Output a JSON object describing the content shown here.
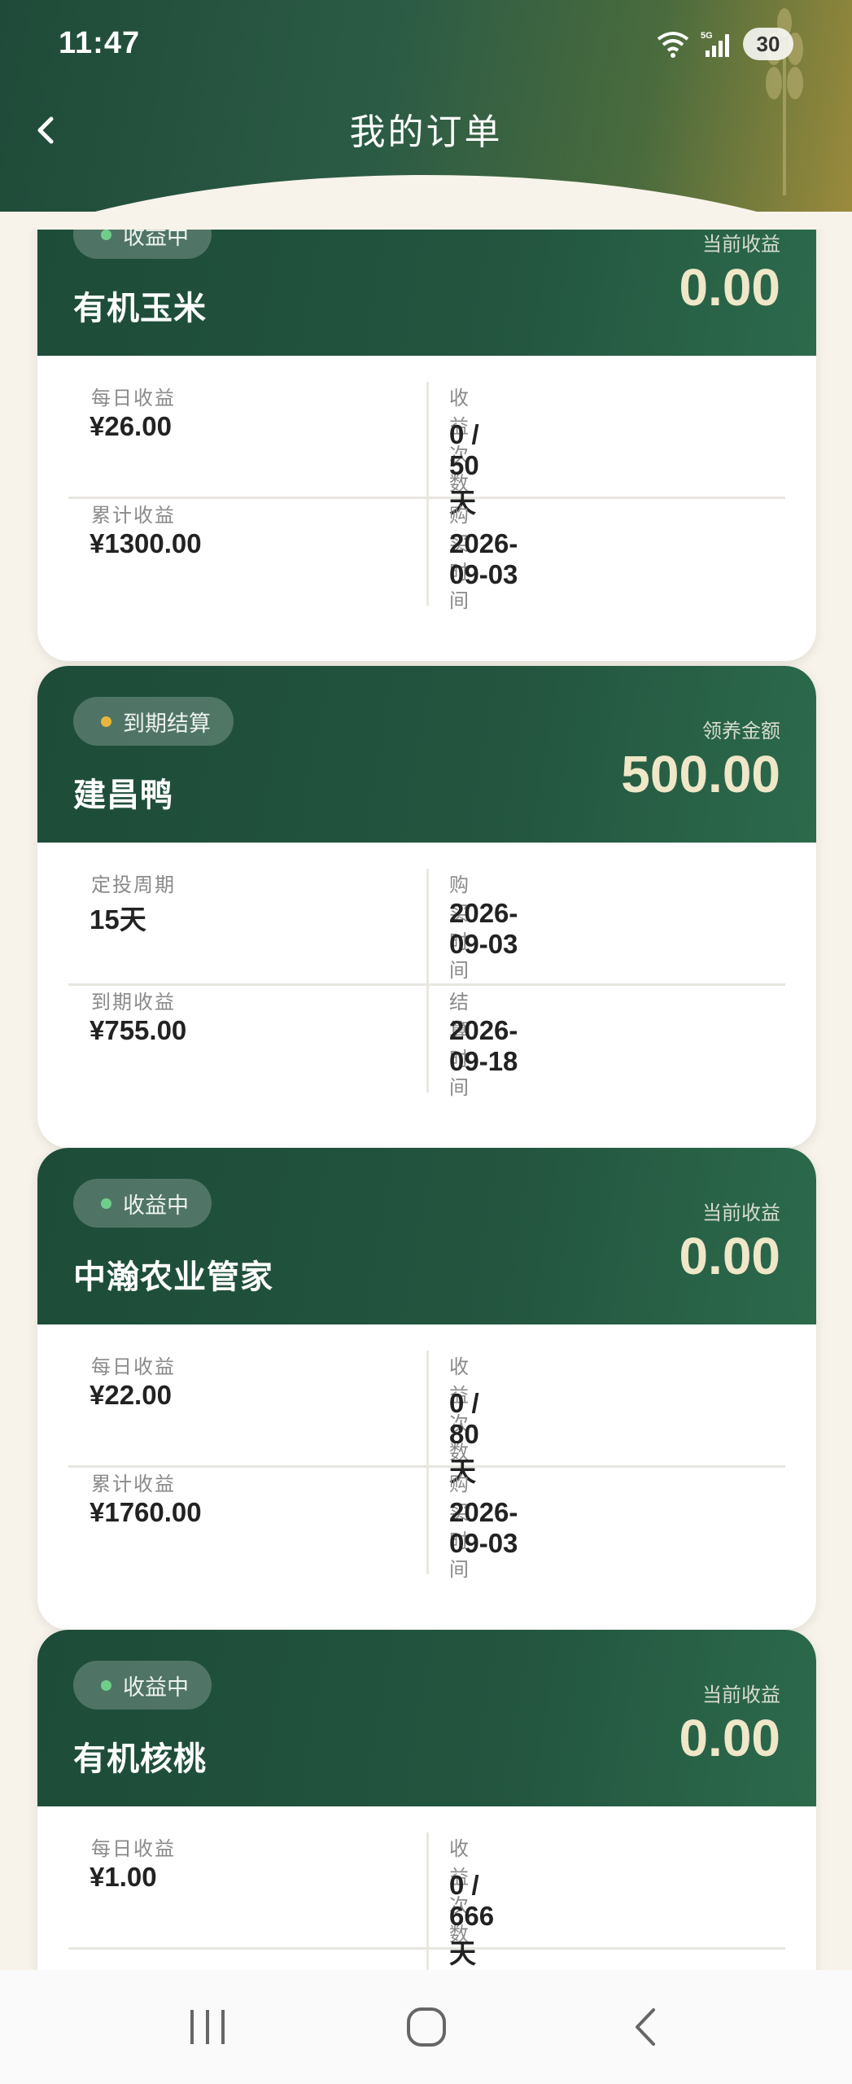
{
  "status_bar": {
    "time": "11:47",
    "battery": "30",
    "network": "5G"
  },
  "header": {
    "title": "我的订单"
  },
  "orders": [
    {
      "status": "收益中",
      "status_color": "#6fcf8a",
      "name": "有机玉米",
      "amount_label": "当前收益",
      "amount": "0.00",
      "cells": [
        {
          "label": "每日收益",
          "value": "¥26.00"
        },
        {
          "label": "收益次数",
          "value": "0 / 50天"
        },
        {
          "label": "累计收益",
          "value": "¥1300.00"
        },
        {
          "label": "购买时间",
          "value": "2026-09-03"
        }
      ]
    },
    {
      "status": "到期结算",
      "status_color": "#e8b63c",
      "name": "建昌鸭",
      "amount_label": "领养金额",
      "amount": "500.00",
      "cells": [
        {
          "label": "定投周期",
          "value": "15天"
        },
        {
          "label": "购买时间",
          "value": "2026-09-03"
        },
        {
          "label": "到期收益",
          "value": "¥755.00"
        },
        {
          "label": "结算时间",
          "value": "2026-09-18"
        }
      ]
    },
    {
      "status": "收益中",
      "status_color": "#6fcf8a",
      "name": "中瀚农业管家",
      "amount_label": "当前收益",
      "amount": "0.00",
      "cells": [
        {
          "label": "每日收益",
          "value": "¥22.00"
        },
        {
          "label": "收益次数",
          "value": "0 / 80天"
        },
        {
          "label": "累计收益",
          "value": "¥1760.00"
        },
        {
          "label": "购买时间",
          "value": "2026-09-03"
        }
      ]
    },
    {
      "status": "收益中",
      "status_color": "#6fcf8a",
      "name": "有机核桃",
      "amount_label": "当前收益",
      "amount": "0.00",
      "cells": [
        {
          "label": "每日收益",
          "value": "¥1.00"
        },
        {
          "label": "收益次数",
          "value": "0 / 666天"
        }
      ]
    }
  ],
  "nav_icons": [
    "recent-apps-icon",
    "home-icon",
    "back-icon"
  ]
}
